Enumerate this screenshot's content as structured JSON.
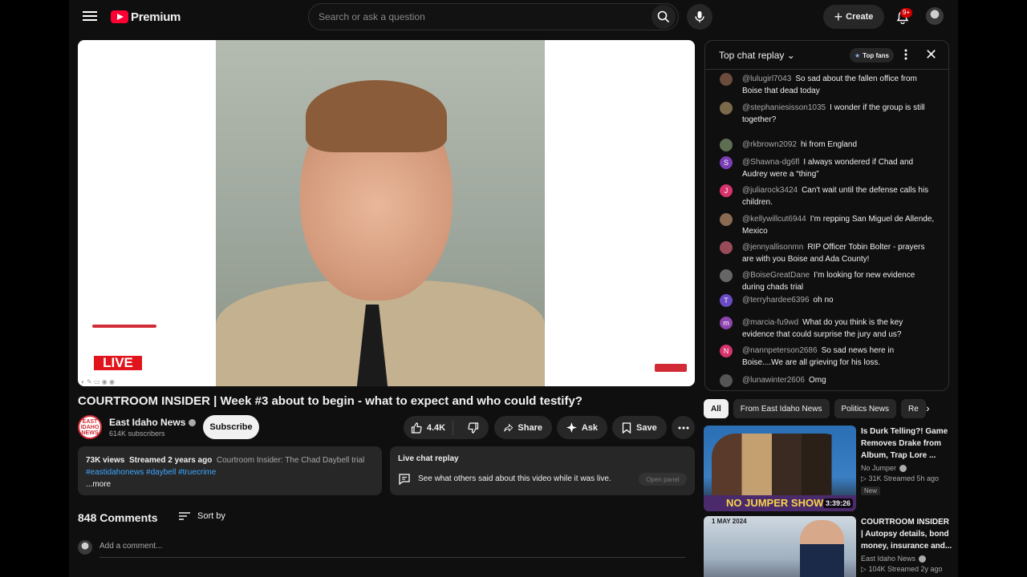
{
  "header": {
    "logo_text": "Premium",
    "search_placeholder": "Search or ask a question",
    "create_label": "Create",
    "notif_badge": "9+"
  },
  "player": {
    "live_text": "LIVE"
  },
  "video": {
    "title": "COURTROOM INSIDER | Week #3 about to begin - what to expect and who could testify?",
    "channel_name": "East Idaho News",
    "channel_avatar_text": "EAST IDAHO NEWS",
    "subscribers": "614K subscribers",
    "subscribe_label": "Subscribe",
    "likes": "4.4K",
    "share_label": "Share",
    "ask_label": "Ask",
    "save_label": "Save"
  },
  "description": {
    "views": "73K views",
    "streamed": "Streamed 2 years ago",
    "playlist": "Courtroom Insider: The Chad Daybell trial",
    "tags": "#eastidahonews #daybell #truecrime",
    "more": "...more"
  },
  "live_chat_card": {
    "title": "Live chat replay",
    "subtitle": "See what others said about this video while it was live.",
    "open_panel": "Open panel"
  },
  "comments": {
    "count_label": "848 Comments",
    "sort_label": "Sort by",
    "add_placeholder": "Add a comment..."
  },
  "chat": {
    "title": "Top chat replay",
    "top_fans": "Top fans",
    "messages": [
      {
        "user": "@lulugirl7043",
        "text": "So sad about the fallen office from Boise that dead today",
        "avatar": "",
        "color": "#6b4b3c"
      },
      {
        "user": "@stephaniesisson1035",
        "text": "I wonder if the group is still together?",
        "avatar": "",
        "color": "#7a6a4a"
      },
      {
        "user": "@rkbrown2092",
        "text": "hi from England",
        "avatar": "",
        "color": "#5e6e52"
      },
      {
        "user": "@Shawna-dg6fl",
        "text": "I always wondered if Chad and Audrey were a “thing”",
        "avatar": "S",
        "color": "#7b3fb5"
      },
      {
        "user": "@juliarock3424",
        "text": "Can't wait until the defense calls his children.",
        "avatar": "J",
        "color": "#d6336c"
      },
      {
        "user": "@kellywillcut6944",
        "text": "I’m repping San Miguel de Allende, Mexico",
        "avatar": "",
        "color": "#8a6a50"
      },
      {
        "user": "@jennyallisonmn",
        "text": "RIP Officer Tobin Bolter - prayers are with you Boise and Ada County!",
        "avatar": "",
        "color": "#9a4b5a"
      },
      {
        "user": "@BoiseGreatDane",
        "text": "I’m looking for new evidence during chads trial",
        "avatar": "",
        "color": "#666666"
      },
      {
        "user": "@terryhardee6396",
        "text": "oh no",
        "avatar": "T",
        "color": "#6a4bc4"
      },
      {
        "user": "@marcia-fu9wd",
        "text": "What do you think is the key evidence that could surprise the jury and us?",
        "avatar": "m",
        "color": "#8e44ad"
      },
      {
        "user": "@nannpeterson2686",
        "text": "So sad news here in Boise....We are all grieving for his loss.",
        "avatar": "N",
        "color": "#d6336c"
      },
      {
        "user": "@lunawinter2606",
        "text": "Omg",
        "avatar": "",
        "color": "#555555"
      }
    ]
  },
  "chips": [
    "All",
    "From East Idaho News",
    "Politics News",
    "Re"
  ],
  "related": [
    {
      "title": "Is Durk Telling?! Game Removes Drake from Album, Trap Lore ...",
      "channel": "No Jumper",
      "stats": "31K  Streamed 5h ago",
      "duration": "3:39:26",
      "badge": "New",
      "thumb_text": "NO JUMPER SHOW"
    },
    {
      "title": "COURTROOM INSIDER | Autopsy details, bond money, insurance and...",
      "channel": "East Idaho News",
      "stats": "104K  Streamed 2y ago",
      "thumb_text": "1 MAY 2024"
    }
  ]
}
